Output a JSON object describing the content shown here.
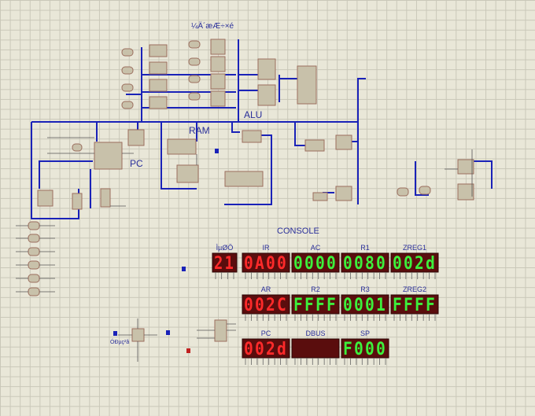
{
  "schematic": {
    "labels": {
      "register_group": "¼Ä´æÆ÷×é",
      "alu": "ALU",
      "ram": "RAM",
      "pc": "PC",
      "console": "CONSOLE",
      "bottom_left": "ÓÐµç²â"
    },
    "colors": {
      "wire": "#1a22b8",
      "component": "#c8c1aa",
      "display_on_red": "#ff2a2a",
      "display_on_green": "#3cf03c",
      "grid_background": "#e9e7d8"
    }
  },
  "console": {
    "displays": [
      {
        "label": "ÌµØÖ",
        "value": "21",
        "color": "red"
      },
      {
        "label": "IR",
        "value": "0A00",
        "color": "red"
      },
      {
        "label": "AC",
        "value": "0000",
        "color": "green"
      },
      {
        "label": "R1",
        "value": "0080",
        "color": "green"
      },
      {
        "label": "ZREG1",
        "value": "002d",
        "color": "green"
      },
      {
        "label": "AR",
        "value": "002C",
        "color": "red"
      },
      {
        "label": "R2",
        "value": "FFFF",
        "color": "green"
      },
      {
        "label": "R3",
        "value": "0001",
        "color": "green"
      },
      {
        "label": "ZREG2",
        "value": "FFFF",
        "color": "green"
      },
      {
        "label": "PC",
        "value": "002d",
        "color": "red"
      },
      {
        "label": "DBUS",
        "value": "",
        "color": "red"
      },
      {
        "label": "SP",
        "value": "F000",
        "color": "green"
      }
    ]
  }
}
